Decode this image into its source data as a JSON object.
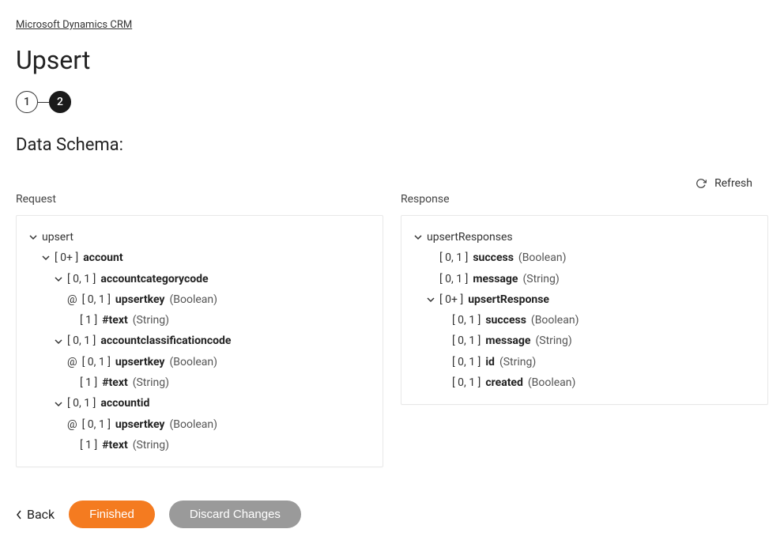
{
  "breadcrumb": "Microsoft Dynamics CRM",
  "page_title": "Upsert",
  "steps": {
    "one": "1",
    "two": "2"
  },
  "section_title": "Data Schema:",
  "refresh_label": "Refresh",
  "request_label": "Request",
  "response_label": "Response",
  "request_tree": {
    "root": "upsert",
    "account_card": "[ 0+ ]",
    "account_name": "account",
    "cat_card": "[ 0, 1 ]",
    "cat_name": "accountcategorycode",
    "cat_uk_card": "[ 0, 1 ]",
    "cat_uk_name": "upsertkey",
    "cat_uk_type": "(Boolean)",
    "cat_txt_card": "[ 1 ]",
    "cat_txt_name": "#text",
    "cat_txt_type": "(String)",
    "cls_card": "[ 0, 1 ]",
    "cls_name": "accountclassificationcode",
    "cls_uk_card": "[ 0, 1 ]",
    "cls_uk_name": "upsertkey",
    "cls_uk_type": "(Boolean)",
    "cls_txt_card": "[ 1 ]",
    "cls_txt_name": "#text",
    "cls_txt_type": "(String)",
    "aid_card": "[ 0, 1 ]",
    "aid_name": "accountid",
    "aid_uk_card": "[ 0, 1 ]",
    "aid_uk_name": "upsertkey",
    "aid_uk_type": "(Boolean)",
    "aid_txt_card": "[ 1 ]",
    "aid_txt_name": "#text",
    "aid_txt_type": "(String)"
  },
  "response_tree": {
    "root": "upsertResponses",
    "success_card": "[ 0, 1 ]",
    "success_name": "success",
    "success_type": "(Boolean)",
    "message_card": "[ 0, 1 ]",
    "message_name": "message",
    "message_type": "(String)",
    "ur_card": "[ 0+ ]",
    "ur_name": "upsertResponse",
    "ur_success_card": "[ 0, 1 ]",
    "ur_success_name": "success",
    "ur_success_type": "(Boolean)",
    "ur_message_card": "[ 0, 1 ]",
    "ur_message_name": "message",
    "ur_message_type": "(String)",
    "ur_id_card": "[ 0, 1 ]",
    "ur_id_name": "id",
    "ur_id_type": "(String)",
    "ur_created_card": "[ 0, 1 ]",
    "ur_created_name": "created",
    "ur_created_type": "(Boolean)"
  },
  "actions": {
    "back": "Back",
    "finished": "Finished",
    "discard": "Discard Changes"
  }
}
